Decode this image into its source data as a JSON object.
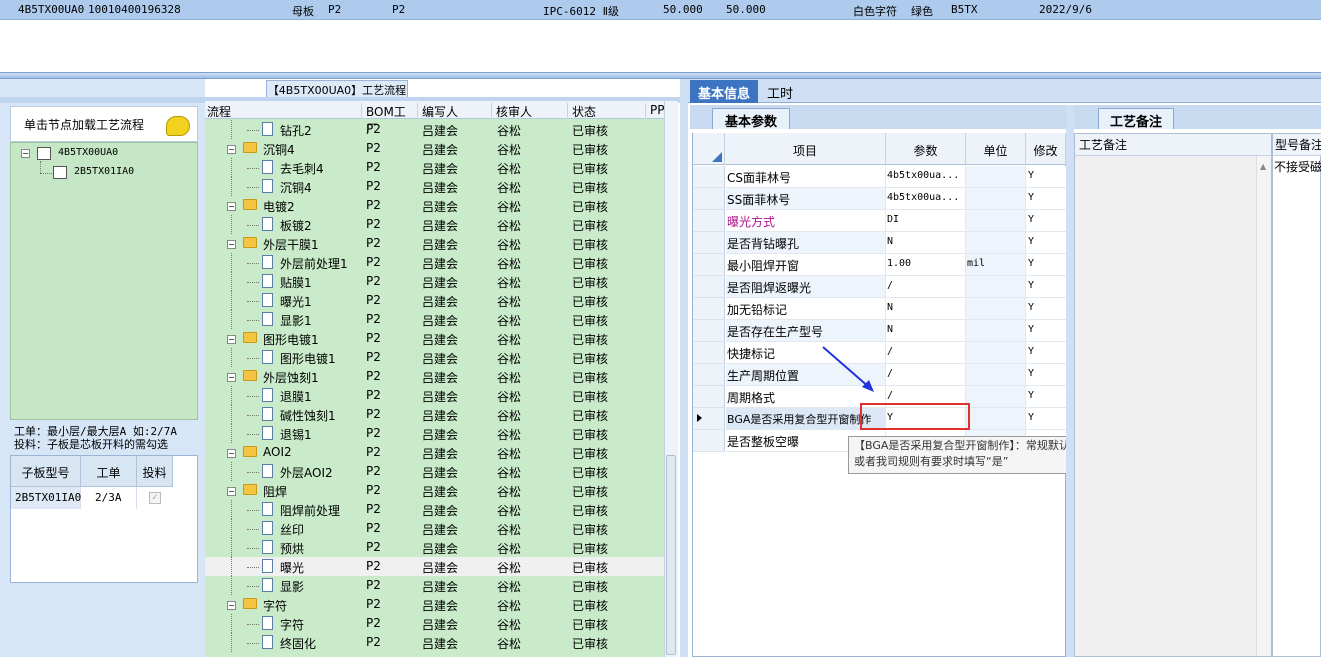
{
  "top_row": {
    "cells": [
      "4B5TX00UA0",
      "10010400196328",
      "母板",
      "P2",
      "P2",
      "IPC-6012 Ⅱ级",
      "50.000",
      "50.000",
      "白色字符",
      "绿色",
      "B5TX",
      "2022/9/6"
    ]
  },
  "flow_title": "【4B5TX00UA0】工艺流程",
  "left": {
    "load_button": "单击节点加载工艺流程",
    "tree": [
      {
        "label": "4B5TX00UA0"
      },
      {
        "label": "2B5TX01IA0"
      }
    ],
    "info_line1": "工单：最小层/最大层A 如:2/7A",
    "info_line2": "投料：子板是芯板开料的需勾选",
    "subgrid": {
      "headers": [
        "子板型号",
        "工单",
        "投料"
      ],
      "rows": [
        {
          "model": "2B5TX01IA0",
          "order": "2/3A"
        }
      ]
    }
  },
  "flow_grid": {
    "headers": [
      "流程",
      "BOM工厂",
      "编写人",
      "核审人",
      "状态",
      "PP("
    ],
    "rows": [
      {
        "name": "钻孔2",
        "level": 1,
        "bom": "P2",
        "writer": "吕建会",
        "reviewer": "谷松",
        "status": "已审核"
      },
      {
        "name": "沉铜4",
        "level": 0,
        "bom": "P2",
        "writer": "吕建会",
        "reviewer": "谷松",
        "status": "已审核"
      },
      {
        "name": "去毛刺4",
        "level": 1,
        "bom": "P2",
        "writer": "吕建会",
        "reviewer": "谷松",
        "status": "已审核"
      },
      {
        "name": "沉铜4",
        "level": 1,
        "bom": "P2",
        "writer": "吕建会",
        "reviewer": "谷松",
        "status": "已审核"
      },
      {
        "name": "电镀2",
        "level": 0,
        "bom": "P2",
        "writer": "吕建会",
        "reviewer": "谷松",
        "status": "已审核"
      },
      {
        "name": "板镀2",
        "level": 1,
        "bom": "P2",
        "writer": "吕建会",
        "reviewer": "谷松",
        "status": "已审核"
      },
      {
        "name": "外层干膜1",
        "level": 0,
        "bom": "P2",
        "writer": "吕建会",
        "reviewer": "谷松",
        "status": "已审核"
      },
      {
        "name": "外层前处理1",
        "level": 1,
        "bom": "P2",
        "writer": "吕建会",
        "reviewer": "谷松",
        "status": "已审核"
      },
      {
        "name": "贴膜1",
        "level": 1,
        "bom": "P2",
        "writer": "吕建会",
        "reviewer": "谷松",
        "status": "已审核"
      },
      {
        "name": "曝光1",
        "level": 1,
        "bom": "P2",
        "writer": "吕建会",
        "reviewer": "谷松",
        "status": "已审核"
      },
      {
        "name": "显影1",
        "level": 1,
        "bom": "P2",
        "writer": "吕建会",
        "reviewer": "谷松",
        "status": "已审核"
      },
      {
        "name": "图形电镀1",
        "level": 0,
        "bom": "P2",
        "writer": "吕建会",
        "reviewer": "谷松",
        "status": "已审核"
      },
      {
        "name": "图形电镀1",
        "level": 1,
        "bom": "P2",
        "writer": "吕建会",
        "reviewer": "谷松",
        "status": "已审核"
      },
      {
        "name": "外层蚀刻1",
        "level": 0,
        "bom": "P2",
        "writer": "吕建会",
        "reviewer": "谷松",
        "status": "已审核"
      },
      {
        "name": "退膜1",
        "level": 1,
        "bom": "P2",
        "writer": "吕建会",
        "reviewer": "谷松",
        "status": "已审核"
      },
      {
        "name": "碱性蚀刻1",
        "level": 1,
        "bom": "P2",
        "writer": "吕建会",
        "reviewer": "谷松",
        "status": "已审核"
      },
      {
        "name": "退锡1",
        "level": 1,
        "bom": "P2",
        "writer": "吕建会",
        "reviewer": "谷松",
        "status": "已审核"
      },
      {
        "name": "AOI2",
        "level": 0,
        "bom": "P2",
        "writer": "吕建会",
        "reviewer": "谷松",
        "status": "已审核"
      },
      {
        "name": "外层AOI2",
        "level": 1,
        "bom": "P2",
        "writer": "吕建会",
        "reviewer": "谷松",
        "status": "已审核"
      },
      {
        "name": "阻焊",
        "level": 0,
        "bom": "P2",
        "writer": "吕建会",
        "reviewer": "谷松",
        "status": "已审核"
      },
      {
        "name": "阻焊前处理",
        "level": 1,
        "bom": "P2",
        "writer": "吕建会",
        "reviewer": "谷松",
        "status": "已审核"
      },
      {
        "name": "丝印",
        "level": 1,
        "bom": "P2",
        "writer": "吕建会",
        "reviewer": "谷松",
        "status": "已审核"
      },
      {
        "name": "预烘",
        "level": 1,
        "bom": "P2",
        "writer": "吕建会",
        "reviewer": "谷松",
        "status": "已审核"
      },
      {
        "name": "曝光",
        "level": 1,
        "bom": "P2",
        "writer": "吕建会",
        "reviewer": "谷松",
        "status": "已审核",
        "selected": true
      },
      {
        "name": "显影",
        "level": 1,
        "bom": "P2",
        "writer": "吕建会",
        "reviewer": "谷松",
        "status": "已审核"
      },
      {
        "name": "字符",
        "level": 0,
        "bom": "P2",
        "writer": "吕建会",
        "reviewer": "谷松",
        "status": "已审核"
      },
      {
        "name": "字符",
        "level": 1,
        "bom": "P2",
        "writer": "吕建会",
        "reviewer": "谷松",
        "status": "已审核"
      },
      {
        "name": "终固化",
        "level": 1,
        "bom": "P2",
        "writer": "吕建会",
        "reviewer": "谷松",
        "status": "已审核"
      }
    ]
  },
  "right": {
    "tabs": [
      "基本信息",
      "工时"
    ],
    "subtab": "基本参数",
    "param_headers": [
      "项目",
      "参数",
      "单位",
      "修改"
    ],
    "params": [
      {
        "item": "CS面菲林号",
        "value": "4b5tx00ua...",
        "unit": "",
        "mod": "Y"
      },
      {
        "item": "SS面菲林号",
        "value": "4b5tx00ua...",
        "unit": "",
        "mod": "Y"
      },
      {
        "item": "曝光方式",
        "value": "DI",
        "unit": "",
        "mod": "Y",
        "color": "#b0108a"
      },
      {
        "item": "是否背钻曝孔",
        "value": "N",
        "unit": "",
        "mod": "Y"
      },
      {
        "item": "最小阻焊开窗",
        "value": "1.00",
        "unit": "mil",
        "mod": "Y"
      },
      {
        "item": "是否阻焊返曝光",
        "value": "/",
        "unit": "",
        "mod": "Y"
      },
      {
        "item": "加无铅标记",
        "value": "N",
        "unit": "",
        "mod": "Y"
      },
      {
        "item": "是否存在生产型号",
        "value": "N",
        "unit": "",
        "mod": "Y"
      },
      {
        "item": "快捷标记",
        "value": "/",
        "unit": "",
        "mod": "Y"
      },
      {
        "item": "生产周期位置",
        "value": "/",
        "unit": "",
        "mod": "Y"
      },
      {
        "item": "周期格式",
        "value": "/",
        "unit": "",
        "mod": "Y"
      },
      {
        "item": "BGA是否采用复合型开窗制作",
        "value": "Y",
        "unit": "",
        "mod": "Y",
        "current": true
      },
      {
        "item": "是否整板空曝",
        "value": "",
        "unit": "",
        "mod": ""
      }
    ],
    "tooltip": "【BGA是否采用复合型开窗制作】：常规默认“否”，客户有要求或者我司规则有要求时填写“是”",
    "notes_tab": "工艺备注",
    "notes_header": "工艺备注",
    "remark_header": "型号备注",
    "remark_value": "不接受磁"
  }
}
